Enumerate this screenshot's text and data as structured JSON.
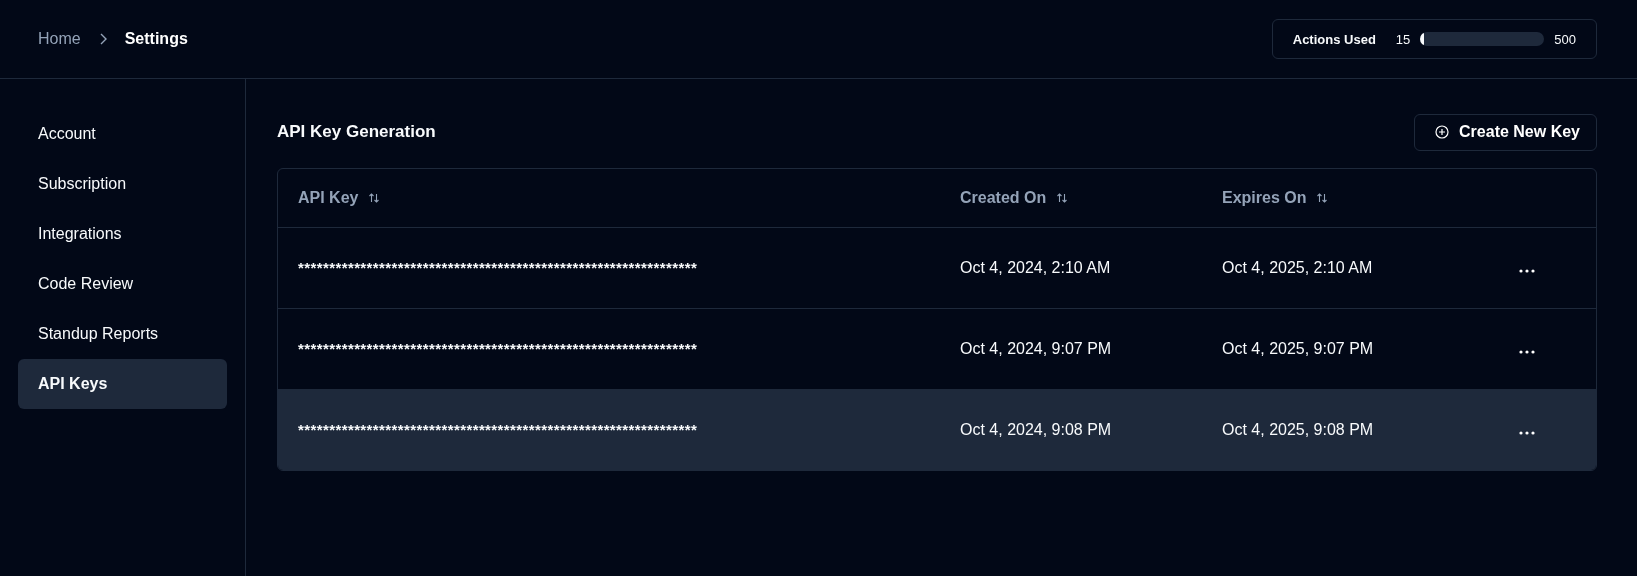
{
  "breadcrumb": [
    "Home",
    "Settings"
  ],
  "usage": {
    "label": "Actions Used",
    "current": "15",
    "max": "500",
    "level": 0.03
  },
  "sidebar": {
    "items": [
      {
        "label": "Account",
        "selected": false
      },
      {
        "label": "Subscription",
        "selected": false
      },
      {
        "label": "Integrations",
        "selected": false
      },
      {
        "label": "Code Review",
        "selected": false
      },
      {
        "label": "Standup Reports",
        "selected": false
      },
      {
        "label": "API Keys",
        "selected": true
      }
    ]
  },
  "section": {
    "title": "API Key Generation",
    "button": "Create New Key"
  },
  "table": {
    "columns": [
      {
        "label": "API Key",
        "sortable": true
      },
      {
        "label": "Created On",
        "sortable": true
      },
      {
        "label": "Expires On",
        "sortable": true
      }
    ],
    "rows": [
      {
        "key": "****************************************************************",
        "created": "Oct 4, 2024, 2:10 AM",
        "expires": "Oct 4, 2025, 2:10 AM",
        "selected": false
      },
      {
        "key": "****************************************************************",
        "created": "Oct 4, 2024, 9:07 PM",
        "expires": "Oct 4, 2025, 9:07 PM",
        "selected": false
      },
      {
        "key": "****************************************************************",
        "created": "Oct 4, 2024, 9:08 PM",
        "expires": "Oct 4, 2025, 9:08 PM",
        "selected": true
      }
    ]
  }
}
